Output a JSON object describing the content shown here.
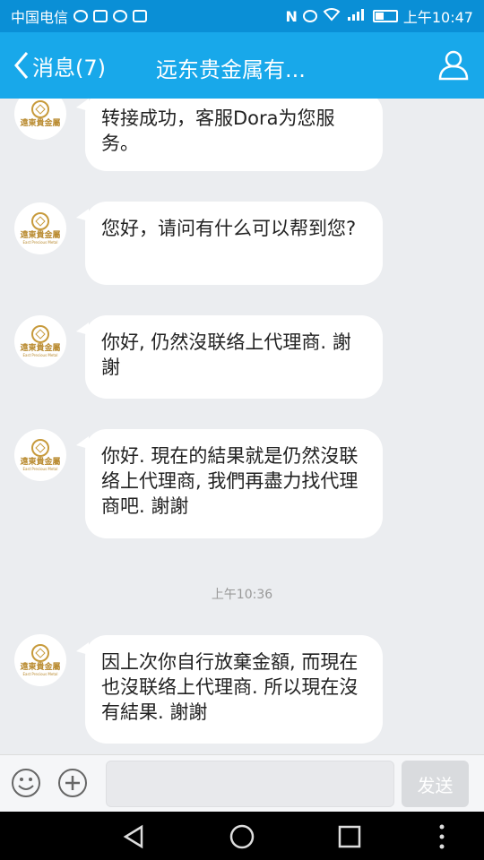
{
  "status_bar": {
    "carrier": "中国电信",
    "time": "上午10:47"
  },
  "header": {
    "back_label": "消息(7)",
    "title": "远东贵金属有..."
  },
  "messages": [
    {
      "text": "转接成功，客服Dora为您服务。"
    },
    {
      "text": "您好，请问有什么可以帮到您?"
    },
    {
      "text": "你好, 仍然沒联络上代理商. 謝謝"
    },
    {
      "text": "你好. 現在的結果就是仍然沒联络上代理商, 我們再盡力找代理商吧. 謝謝"
    },
    {
      "text": "因上次你自行放棄金額, 而現在也沒联络上代理商. 所以現在沒有結果. 謝謝"
    }
  ],
  "timestamp": "上午10:36",
  "avatar": {
    "logo_text": "遠東貴金屬",
    "logo_sub": "East Precious Metal"
  },
  "input_bar": {
    "placeholder": "",
    "send_label": "发送"
  }
}
